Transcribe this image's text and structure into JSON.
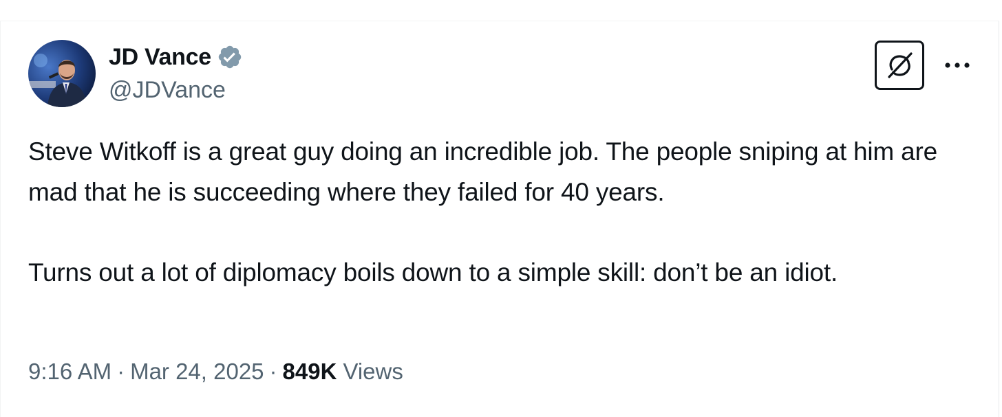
{
  "tweet": {
    "author": {
      "display_name": "JD Vance",
      "handle": "@JDVance",
      "verified": true,
      "verified_color": "#829aab"
    },
    "text": "Steve Witkoff is a great guy doing an incredible job. The people sniping at him are mad that he is succeeding where they failed for 40 years.\n\nTurns out a lot of diplomacy boils down to a simple skill: don’t be an idiot.",
    "time": "9:16 AM",
    "separator": "·",
    "date": "Mar 24, 2025",
    "views_count": "849K",
    "views_label": "Views"
  },
  "actions": {
    "grok_icon": "grok-icon",
    "more_icon": "more-icon"
  }
}
